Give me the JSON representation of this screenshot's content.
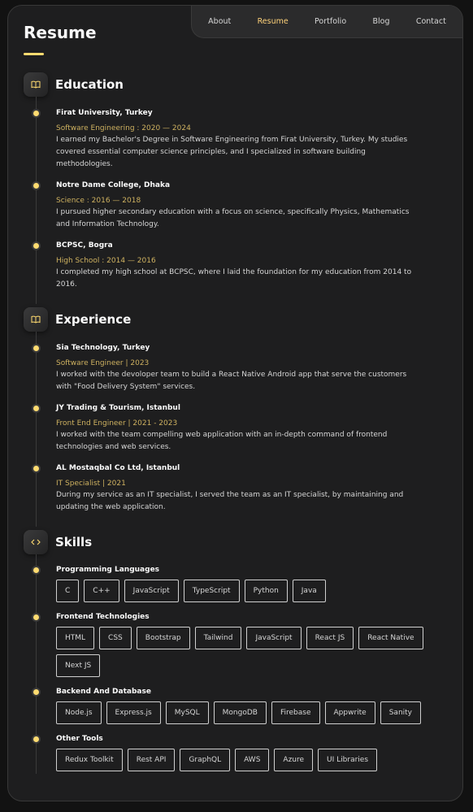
{
  "nav": {
    "items": [
      {
        "label": "About",
        "active": false
      },
      {
        "label": "Resume",
        "active": true
      },
      {
        "label": "Portfolio",
        "active": false
      },
      {
        "label": "Blog",
        "active": false
      },
      {
        "label": "Contact",
        "active": false
      }
    ]
  },
  "page": {
    "title": "Resume"
  },
  "colors": {
    "accent": "#ffdb70",
    "date": "#ceb160",
    "background": "#1e1e1f"
  },
  "education": {
    "title": "Education",
    "icon": "book-icon",
    "items": [
      {
        "title": "Firat University, Turkey",
        "date": "Software Engineering : 2020 — 2024",
        "text": "I earned my Bachelor's Degree in Software Engineering from Firat University, Turkey. My studies covered essential computer science principles, and I specialized in software building methodologies."
      },
      {
        "title": "Notre Dame College, Dhaka",
        "date": "Science : 2016 — 2018",
        "text": "I pursued higher secondary education with a focus on science, specifically Physics, Mathematics and Information Technology."
      },
      {
        "title": "BCPSC, Bogra",
        "date": "High School : 2014 — 2016",
        "text": "I completed my high school at BCPSC, where I laid the foundation for my education from 2014 to 2016."
      }
    ]
  },
  "experience": {
    "title": "Experience",
    "icon": "book-icon",
    "items": [
      {
        "title": "Sia Technology, Turkey",
        "date": "Software Engineer | 2023",
        "text": "I worked with the devoloper team to build a React Native Android app that serve the customers with \"Food Delivery System\" services."
      },
      {
        "title": "JY Trading & Tourism, Istanbul",
        "date": "Front End Engineer | 2021 - 2023",
        "text": "I worked with the team compelling web application with an in-depth command of frontend technologies and web services."
      },
      {
        "title": "AL Mostaqbal Co Ltd, Istanbul",
        "date": "IT Specialist | 2021",
        "text": "During my service as an IT specialist, I served the team as an IT specialist, by maintaining and updating the web application."
      }
    ]
  },
  "skills": {
    "title": "Skills",
    "icon": "code-icon",
    "groups": [
      {
        "title": "Programming Languages",
        "tags": [
          "C",
          "C++",
          "JavaScript",
          "TypeScript",
          "Python",
          "Java"
        ]
      },
      {
        "title": "Frontend Technologies",
        "tags": [
          "HTML",
          "CSS",
          "Bootstrap",
          "Tailwind",
          "JavaScript",
          "React JS",
          "React Native",
          "Next JS"
        ]
      },
      {
        "title": "Backend And Database",
        "tags": [
          "Node.js",
          "Express.js",
          "MySQL",
          "MongoDB",
          "Firebase",
          "Appwrite",
          "Sanity"
        ]
      },
      {
        "title": "Other Tools",
        "tags": [
          "Redux Toolkit",
          "Rest API",
          "GraphQL",
          "AWS",
          "Azure",
          "UI Libraries"
        ]
      }
    ]
  }
}
